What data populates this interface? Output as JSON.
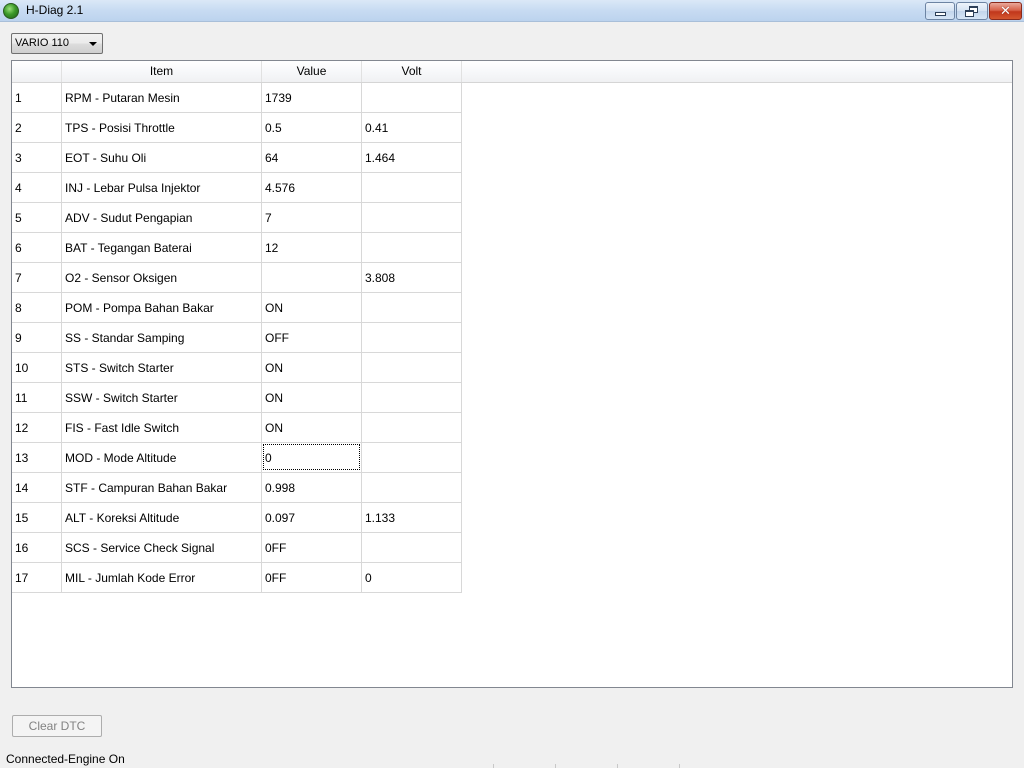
{
  "window": {
    "title": "H-Diag 2.1"
  },
  "model_select": {
    "selected": "VARIO 110"
  },
  "table": {
    "columns": [
      "",
      "Item",
      "Value",
      "Volt"
    ],
    "rows": [
      {
        "no": "1",
        "item": "RPM - Putaran Mesin",
        "value": "1739",
        "volt": ""
      },
      {
        "no": "2",
        "item": "TPS - Posisi Throttle",
        "value": "0.5",
        "volt": "0.41"
      },
      {
        "no": "3",
        "item": "EOT - Suhu Oli",
        "value": "64",
        "volt": "1.464"
      },
      {
        "no": "4",
        "item": "INJ - Lebar Pulsa Injektor",
        "value": "4.576",
        "volt": ""
      },
      {
        "no": "5",
        "item": "ADV - Sudut Pengapian",
        "value": "7",
        "volt": ""
      },
      {
        "no": "6",
        "item": "BAT - Tegangan Baterai",
        "value": "12",
        "volt": ""
      },
      {
        "no": "7",
        "item": "O2 - Sensor Oksigen",
        "value": "",
        "volt": "3.808"
      },
      {
        "no": "8",
        "item": "POM - Pompa Bahan Bakar",
        "value": "ON",
        "volt": ""
      },
      {
        "no": "9",
        "item": "SS - Standar Samping",
        "value": "OFF",
        "volt": ""
      },
      {
        "no": "10",
        "item": "STS - Switch Starter",
        "value": "ON",
        "volt": ""
      },
      {
        "no": "11",
        "item": "SSW - Switch Starter",
        "value": "ON",
        "volt": ""
      },
      {
        "no": "12",
        "item": "FIS - Fast Idle Switch",
        "value": "ON",
        "volt": ""
      },
      {
        "no": "13",
        "item": "MOD - Mode Altitude",
        "value": "0",
        "volt": ""
      },
      {
        "no": "14",
        "item": "STF - Campuran Bahan Bakar",
        "value": "0.998",
        "volt": ""
      },
      {
        "no": "15",
        "item": "ALT - Koreksi Altitude",
        "value": "0.097",
        "volt": "1.133"
      },
      {
        "no": "16",
        "item": "SCS - Service Check Signal",
        "value": "0FF",
        "volt": ""
      },
      {
        "no": "17",
        "item": "MIL - Jumlah Kode Error",
        "value": "0FF",
        "volt": "0"
      }
    ],
    "focused_row": 12
  },
  "buttons": {
    "clear_dtc": "Clear DTC"
  },
  "status": {
    "text": "Connected-Engine On"
  },
  "colors": {
    "titlebar": "#c7dbf2",
    "close_button": "#c1371c",
    "disabled_text": "#838383"
  }
}
